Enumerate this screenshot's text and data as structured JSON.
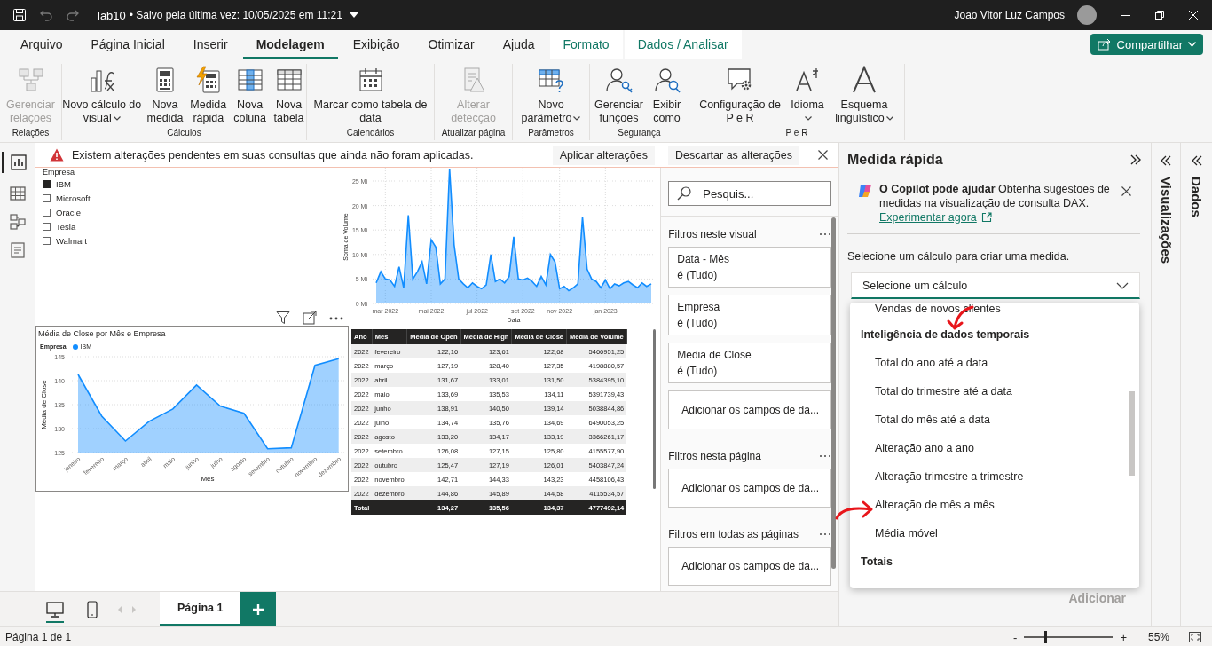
{
  "title_bar": {
    "file_name": "lab10",
    "save_status": "• Salvo pela última vez: 10/05/2025 em 11:21",
    "user_name": "Joao Vitor Luz Campos"
  },
  "menu_tabs": [
    {
      "label": "Arquivo",
      "selected": false,
      "kind": "main"
    },
    {
      "label": "Página Inicial",
      "selected": false,
      "kind": "main"
    },
    {
      "label": "Inserir",
      "selected": false,
      "kind": "main"
    },
    {
      "label": "Modelagem",
      "selected": true,
      "kind": "main"
    },
    {
      "label": "Exibição",
      "selected": false,
      "kind": "main"
    },
    {
      "label": "Otimizar",
      "selected": false,
      "kind": "main"
    },
    {
      "label": "Ajuda",
      "selected": false,
      "kind": "main"
    },
    {
      "label": "Formato",
      "selected": false,
      "kind": "context"
    },
    {
      "label": "Dados / Analisar",
      "selected": false,
      "kind": "context"
    }
  ],
  "share_button": "Compartilhar",
  "ribbon_groups": [
    {
      "label": "Relações",
      "buttons": [
        {
          "label": "Gerenciar relações",
          "disabled": true,
          "dropdown": false
        }
      ]
    },
    {
      "label": "Cálculos",
      "buttons": [
        {
          "label": "Novo cálculo do visual",
          "disabled": false,
          "dropdown": true
        },
        {
          "label": "Nova medida",
          "disabled": false,
          "dropdown": false
        },
        {
          "label": "Medida rápida",
          "disabled": false,
          "dropdown": false
        },
        {
          "label": "Nova coluna",
          "disabled": false,
          "dropdown": false
        },
        {
          "label": "Nova tabela",
          "disabled": false,
          "dropdown": false
        }
      ]
    },
    {
      "label": "Calendários",
      "buttons": [
        {
          "label": "Marcar como tabela de data",
          "disabled": false,
          "dropdown": false
        }
      ]
    },
    {
      "label": "Atualizar página",
      "buttons": [
        {
          "label": "Alterar detecção",
          "disabled": true,
          "dropdown": false
        }
      ]
    },
    {
      "label": "Parâmetros",
      "buttons": [
        {
          "label": "Novo parâmetro",
          "disabled": false,
          "dropdown": true
        }
      ]
    },
    {
      "label": "Segurança",
      "buttons": [
        {
          "label": "Gerenciar funções",
          "disabled": false,
          "dropdown": false
        },
        {
          "label": "Exibir como",
          "disabled": false,
          "dropdown": false
        }
      ]
    },
    {
      "label": "P e R",
      "buttons": [
        {
          "label": "Configuração de P e R",
          "disabled": false,
          "dropdown": false
        },
        {
          "label": "Idioma",
          "disabled": false,
          "dropdown": true
        },
        {
          "label": "Esquema linguístico",
          "disabled": false,
          "dropdown": true
        }
      ]
    }
  ],
  "banner": {
    "message": "Existem alterações pendentes em suas consultas que ainda não foram aplicadas.",
    "buttons": [
      "Aplicar alterações",
      "Descartar as alterações"
    ]
  },
  "slicer": {
    "title": "Empresa",
    "items": [
      {
        "label": "IBM",
        "checked": true
      },
      {
        "label": "Microsoft",
        "checked": false
      },
      {
        "label": "Oracle",
        "checked": false
      },
      {
        "label": "Tesla",
        "checked": false
      },
      {
        "label": "Walmart",
        "checked": false
      }
    ]
  },
  "volume_chart": {
    "chart_data": {
      "type": "area",
      "xlabel": "Data",
      "ylabel": "Soma de Volume",
      "grid": true,
      "categories": [
        null,
        null,
        "mar 2022",
        null,
        null,
        null,
        null,
        null,
        null,
        null,
        null,
        null,
        "mai 2022",
        null,
        null,
        null,
        null,
        null,
        null,
        null,
        null,
        null,
        "jul 2022",
        null,
        null,
        null,
        null,
        null,
        null,
        null,
        null,
        null,
        "set 2022",
        null,
        null,
        null,
        null,
        null,
        null,
        null,
        "nov 2022",
        null,
        null,
        null,
        null,
        null,
        null,
        null,
        null,
        null,
        "jan 2023",
        null,
        null,
        null,
        null,
        null,
        null,
        null,
        null,
        null,
        null
      ],
      "series": [
        {
          "color": "#118dff",
          "values": [
            4.2,
            6.5,
            5,
            4.8,
            3.5,
            7.5,
            3.2,
            18,
            5,
            6.5,
            8.5,
            4,
            13,
            11.5,
            4,
            5,
            27.5,
            12,
            5,
            4,
            3.2,
            4.2,
            3.5,
            3,
            3.8,
            10,
            4.5,
            5,
            4.2,
            5.5,
            13.6,
            5,
            4.8,
            5.2,
            4.5,
            3.5,
            5.5,
            3.8,
            10,
            8.5,
            3,
            3.5,
            2.6,
            3.2,
            4,
            17.6,
            7,
            5,
            4.5,
            3.2,
            4.8,
            3,
            4,
            3.6,
            4.2,
            4.5,
            3.8,
            3.2,
            4.2,
            3.5,
            4
          ]
        }
      ],
      "ylim": [
        0,
        27.5
      ],
      "yticks": [
        {
          "value": 0,
          "label": "0 Mi"
        },
        {
          "value": 5,
          "label": "5 Mi"
        },
        {
          "value": 10,
          "label": "10 Mi"
        },
        {
          "value": 15,
          "label": "15 Mi"
        },
        {
          "value": 20,
          "label": "20 Mi"
        },
        {
          "value": 25,
          "label": "25 Mi"
        }
      ]
    }
  },
  "close_chart": {
    "title": "Média de Close por Mês e Empresa",
    "legend_title": "Empresa",
    "chart_data": {
      "type": "area",
      "xlabel": "Mês",
      "ylabel": "Média de Close",
      "grid": true,
      "categories": [
        "janeiro",
        "fevereiro",
        "março",
        "abril",
        "maio",
        "junho",
        "julho",
        "agosto",
        "setembro",
        "outubro",
        "novembro",
        "dezembro"
      ],
      "series": [
        {
          "name": "IBM",
          "color": "#118dff",
          "values": [
            141.3,
            132.6,
            127.4,
            131.5,
            134.1,
            139.1,
            134.7,
            133.2,
            125.8,
            126.0,
            143.2,
            144.6
          ]
        }
      ],
      "ylim": [
        125,
        145
      ],
      "yticks": [
        125,
        130,
        135,
        140,
        145
      ]
    }
  },
  "table": {
    "columns": [
      "Ano",
      "Mês",
      "Média de Open",
      "Média de High",
      "Média de Close",
      "Média de Volume"
    ],
    "rows": [
      [
        "2022",
        "fevereiro",
        "122,16",
        "123,61",
        "122,68",
        "5466951,25"
      ],
      [
        "2022",
        "março",
        "127,19",
        "128,40",
        "127,35",
        "4198880,57"
      ],
      [
        "2022",
        "abril",
        "131,67",
        "133,01",
        "131,50",
        "5384395,10"
      ],
      [
        "2022",
        "maio",
        "133,69",
        "135,53",
        "134,11",
        "5391739,43"
      ],
      [
        "2022",
        "junho",
        "138,91",
        "140,50",
        "139,14",
        "5038844,86"
      ],
      [
        "2022",
        "julho",
        "134,74",
        "135,76",
        "134,69",
        "6490053,25"
      ],
      [
        "2022",
        "agosto",
        "133,20",
        "134,17",
        "133,19",
        "3366261,17"
      ],
      [
        "2022",
        "setembro",
        "126,08",
        "127,15",
        "125,80",
        "4155577,90"
      ],
      [
        "2022",
        "outubro",
        "125,47",
        "127,19",
        "126,01",
        "5403847,24"
      ],
      [
        "2022",
        "novembro",
        "142,71",
        "144,33",
        "143,23",
        "4458106,43"
      ],
      [
        "2022",
        "dezembro",
        "144,86",
        "145,89",
        "144,58",
        "4115534,57"
      ]
    ],
    "total": {
      "label": "Total",
      "values": [
        "134,27",
        "135,56",
        "134,37",
        "4777492,14"
      ]
    }
  },
  "filters": {
    "search_placeholder": "Pesquis...",
    "sections": [
      {
        "title": "Filtros neste visual",
        "cards": [
          {
            "field": "Data - Mês",
            "condition": "é (Tudo)"
          },
          {
            "field": "Empresa",
            "condition": "é (Tudo)"
          },
          {
            "field": "Média de Close",
            "condition": "é (Tudo)"
          }
        ],
        "add_text": "Adicionar os campos de da..."
      },
      {
        "title": "Filtros nesta página",
        "add_text": "Adicionar os campos de da..."
      },
      {
        "title": "Filtros em todas as páginas",
        "add_text": "Adicionar os campos de da..."
      }
    ]
  },
  "quick_measure": {
    "title": "Medida rápida",
    "copilot_text": "**O Copilot pode ajudar** Obtenha sugestões de medidas na visualização de consulta DAX.",
    "copilot_link": "Experimentar agora",
    "instruction": "Selecione um cálculo para criar uma medida.",
    "select_value": "Selecione um cálculo",
    "options": [
      {
        "label": "Vendas de novos clientes",
        "kind": "option"
      },
      {
        "label": "Inteligência de dados temporais",
        "kind": "group"
      },
      {
        "label": "Total do ano até a data",
        "kind": "option"
      },
      {
        "label": "Total do trimestre até a data",
        "kind": "option"
      },
      {
        "label": "Total do mês até a data",
        "kind": "option"
      },
      {
        "label": "Alteração ano a ano",
        "kind": "option"
      },
      {
        "label": "Alteração trimestre a trimestre",
        "kind": "option"
      },
      {
        "label": "Alteração de mês a mês",
        "kind": "option"
      },
      {
        "label": "Média móvel",
        "kind": "option"
      },
      {
        "label": "Totais",
        "kind": "group"
      }
    ],
    "add_button": {
      "label": "Adicionar",
      "disabled": true
    }
  },
  "side_panes": [
    "Visualizações",
    "Dados"
  ],
  "page_tabs": [
    {
      "label": "Página 1",
      "selected": true
    }
  ],
  "status_bar": {
    "page_info": "Página 1 de 1",
    "zoom_minus": "-",
    "zoom_plus": "+",
    "zoom_reading": "55%",
    "zoom": {
      "level": 0.23
    }
  }
}
